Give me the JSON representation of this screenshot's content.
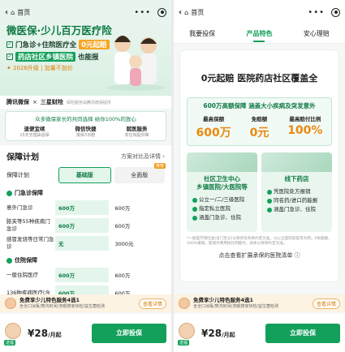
{
  "nav": {
    "home_label": "首页"
  },
  "left": {
    "hero": {
      "title": "微医保·少儿百万医疗险",
      "line1_prefix": "门急诊+住院医疗全",
      "line1_hl": "0元起赔",
      "line2_hl": "药店社区乡镇医院",
      "line2_suffix": "也能报",
      "price_note": "2026升级 | 加量不加价"
    },
    "brand": {
      "name1": "腾讯微保",
      "name2": "三星财险",
      "note": "保险服务由腾讯微保提供"
    },
    "features": {
      "head": "众多微保家长的共同选择  给你100%的放心",
      "items": [
        {
          "t": "速便宜续",
          "s": "15天无理由退保"
        },
        {
          "t": "微信快捷",
          "s": "报保3日赔"
        },
        {
          "t": "就医服务",
          "s": "享住院提供等"
        }
      ]
    },
    "plan": {
      "title": "保障计划",
      "link": "方案对比及详情 ›",
      "label": "保障计划",
      "basic": "基础版",
      "full": "全面版",
      "badge": "推荐",
      "group1": "门急诊保障",
      "rows1": [
        {
          "name": "意外门急诊",
          "a": "600万",
          "b": "600万"
        },
        {
          "name": "脓夹等55种疾病门急诊",
          "a": "600万",
          "b": "600万"
        },
        {
          "name": "感冒发烧等日常门急诊",
          "a": "无",
          "b": "3000元"
        }
      ],
      "group2": "住院保障",
      "rows2": [
        {
          "name": "一般住院医疗",
          "a": "600万",
          "b": "600万"
        },
        {
          "name": "136种疾病医疗(含",
          "a": "600万",
          "b": "600万"
        }
      ]
    }
  },
  "right": {
    "tabs": [
      "我要投保",
      "产品特色",
      "安心理赔"
    ],
    "title": "0元起赔  医院药店社区覆盖全",
    "guard": {
      "head": "600万高额保障 涵盖大小疾病及突发意外",
      "cols": [
        {
          "l": "最高保额",
          "v": "600万"
        },
        {
          "l": "免赔额",
          "v": "0元"
        },
        {
          "l": "最高赔付比例",
          "v": "100%"
        }
      ]
    },
    "panel1": {
      "title": "社区卫生中心\n乡镇医院/大医院等",
      "items": [
        "公立一/二/三级医院",
        "指定私立医院",
        "涵盖门急诊、住院"
      ]
    },
    "panel2": {
      "title": "线下药店",
      "items": [
        "凭医院处方报销",
        "同名药/进口药能报",
        "涵盖门急诊、住院"
      ]
    },
    "note": "*一般医疗保险金(含门急诊)以保单及条款约定为准，以公立医院就医等为例，0免赔额，100%报销。医保外费用按比例赔付，具体以保单约定为准。",
    "hospital_link": "点击查看扩展承保的医院清单"
  },
  "promo": {
    "t1": "免费享少儿特色服务4选1",
    "t2": "含全口涂氟/窝沟封闭/洗眼搜家快检/益生菌检测",
    "btn": "查看详情"
  },
  "bottom": {
    "price": "¥28",
    "unit": "/月起",
    "cta": "立即投保",
    "tag": "送福"
  }
}
